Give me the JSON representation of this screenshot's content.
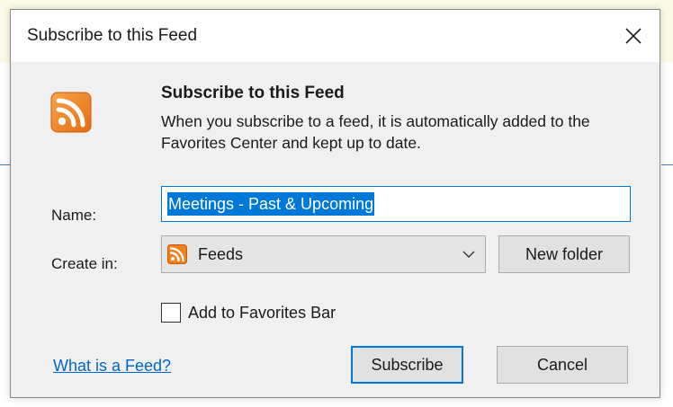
{
  "window": {
    "title": "Subscribe to this Feed"
  },
  "header": {
    "heading": "Subscribe to this Feed",
    "description": "When you subscribe to a feed, it is automatically added to the Favorites Center and kept up to date.",
    "icon": "rss-feed-icon"
  },
  "form": {
    "name_label": "Name:",
    "name_value": "Meetings - Past & Upcoming",
    "create_in_label": "Create in:",
    "create_in_value": "Feeds",
    "new_folder_label": "New folder",
    "favorites_bar_label": "Add to Favorites Bar",
    "favorites_bar_checked": false
  },
  "footer": {
    "help_link": "What is a Feed?",
    "subscribe_label": "Subscribe",
    "cancel_label": "Cancel"
  },
  "colors": {
    "accent": "#0078d7",
    "rss_orange": "#f0811a",
    "link": "#0066cc"
  }
}
